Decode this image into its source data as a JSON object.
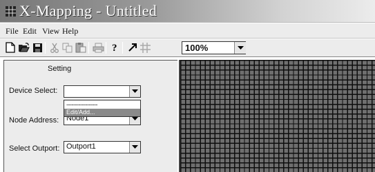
{
  "window": {
    "title": "X-Mapping - Untitled",
    "icon": "grid-app-icon"
  },
  "menu": {
    "items": [
      "File",
      "Edit",
      "View",
      "Help"
    ]
  },
  "toolbar": {
    "buttons": [
      "new-icon",
      "open-icon",
      "save-icon",
      "cut-icon",
      "copy-icon",
      "paste-icon",
      "print-icon",
      "help-pointer-icon",
      "arrow-tool-icon",
      "grid-icon"
    ],
    "zoom": "100%"
  },
  "panel": {
    "title": "Setting",
    "device_select": {
      "label": "Device Select:",
      "value": "",
      "options": [
        "------------------",
        "Edit/Add..."
      ]
    },
    "node_address": {
      "label": "Node Address:",
      "value": "Node1"
    },
    "select_outport": {
      "label": "Select Outport:",
      "value": "Outport1"
    }
  },
  "colors": {
    "title_gradient_start": "#777777",
    "title_gradient_end": "#ececec",
    "panel_bg": "#ececec",
    "grid_fill": "#6f6f6f",
    "grid_lines": "#0d0d0d",
    "highlight": "#8a8a8a"
  }
}
